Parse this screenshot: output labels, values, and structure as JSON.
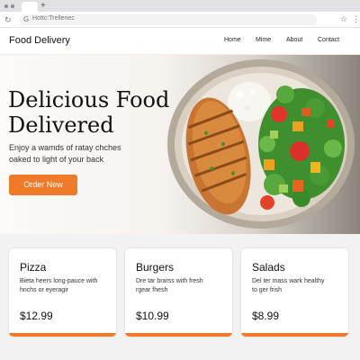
{
  "browser": {
    "url": "Hottc:Trellenec"
  },
  "header": {
    "brand": "Food Delivery",
    "nav": [
      "Home",
      "Mime",
      "About",
      "Contact"
    ]
  },
  "hero": {
    "title_line1": "Delicious Food",
    "title_line2": "Delivered",
    "sub_line1": "Enjoy a wamds of ratay chches",
    "sub_line2": "oaked to light of your back",
    "cta": "Order New"
  },
  "cards": [
    {
      "title": "Pizza",
      "desc_line1": "Bieta heers long-pauce with",
      "desc_line2": "hnchs or eyeragir",
      "price": "$12.99"
    },
    {
      "title": "Burgers",
      "desc_line1": "Dre tar brarss with fresh",
      "desc_line2": "rgear fhesh",
      "price": "$10.99"
    },
    {
      "title": "Salads",
      "desc_line1": "Del ter mass wark healthy",
      "desc_line2": "to ger frish",
      "price": "$8.99"
    }
  ],
  "colors": {
    "accent": "#ee7a2a"
  }
}
